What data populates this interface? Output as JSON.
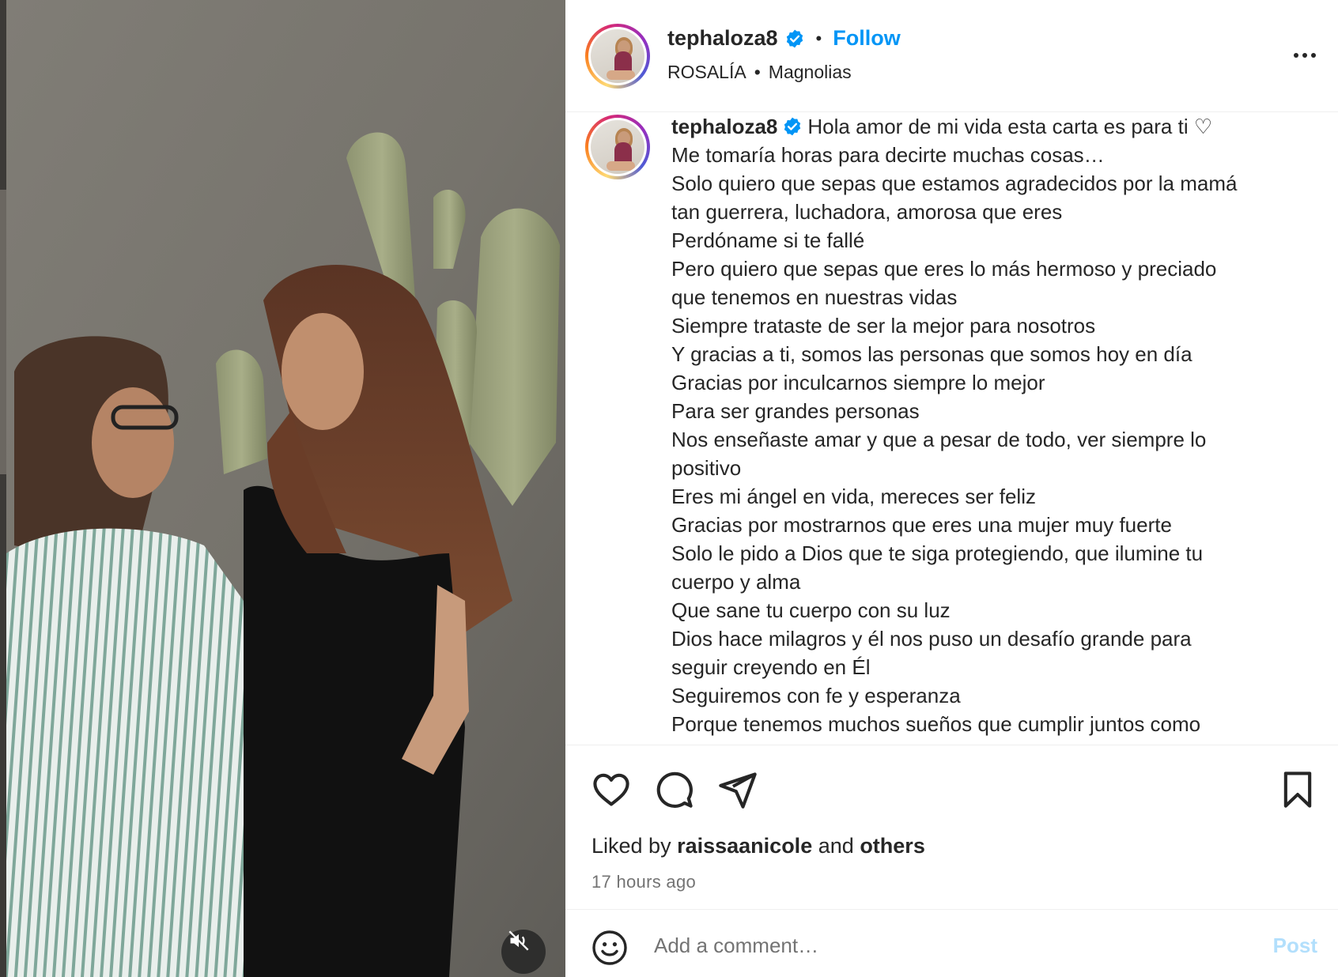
{
  "post": {
    "username": "tephaloza8",
    "follow_label": "Follow",
    "separator": "•",
    "music_artist": "ROSALÍA",
    "music_separator": "•",
    "music_title": "Magnolias",
    "more_options": "more-options-icon"
  },
  "caption": {
    "username": "tephaloza8",
    "first_line": "Hola amor de mi vida esta carta es para ti ♡",
    "lines": [
      "Me tomaría horas para decirte muchas cosas…",
      "Solo quiero que sepas que estamos agradecidos por la mamá",
      "tan guerrera, luchadora, amorosa que eres",
      "Perdóname si te fallé",
      "Pero quiero que sepas que eres lo más hermoso y preciado",
      "que tenemos en nuestras vidas",
      "Siempre trataste de ser la mejor para nosotros",
      "Y gracias a ti, somos las personas que somos hoy en día",
      "Gracias por inculcarnos siempre lo mejor",
      "Para ser grandes personas",
      "Nos enseñaste amar y que a pesar de todo, ver siempre lo",
      "positivo",
      "Eres mi ángel en vida, mereces ser feliz",
      "Gracias por mostrarnos que eres una mujer muy fuerte",
      "Solo le pido a Dios que te siga protegiendo, que ilumine tu",
      "cuerpo y alma",
      "Que sane tu cuerpo con su luz",
      "Dios hace milagros y él nos puso un desafío grande para",
      "seguir creyendo en Él",
      "Seguiremos con fe y esperanza",
      "Porque tenemos muchos sueños que cumplir juntos como"
    ]
  },
  "engagement": {
    "liked_by_prefix": "Liked by",
    "liked_by_user": "raissaanicole",
    "liked_by_and": "and",
    "liked_by_others": "others",
    "time_ago": "17 hours ago"
  },
  "comment": {
    "placeholder": "Add a comment…",
    "post_label": "Post"
  },
  "colors": {
    "accent": "#0095f6",
    "post_disabled": "#b2dffc",
    "verified": "#0095f6"
  }
}
